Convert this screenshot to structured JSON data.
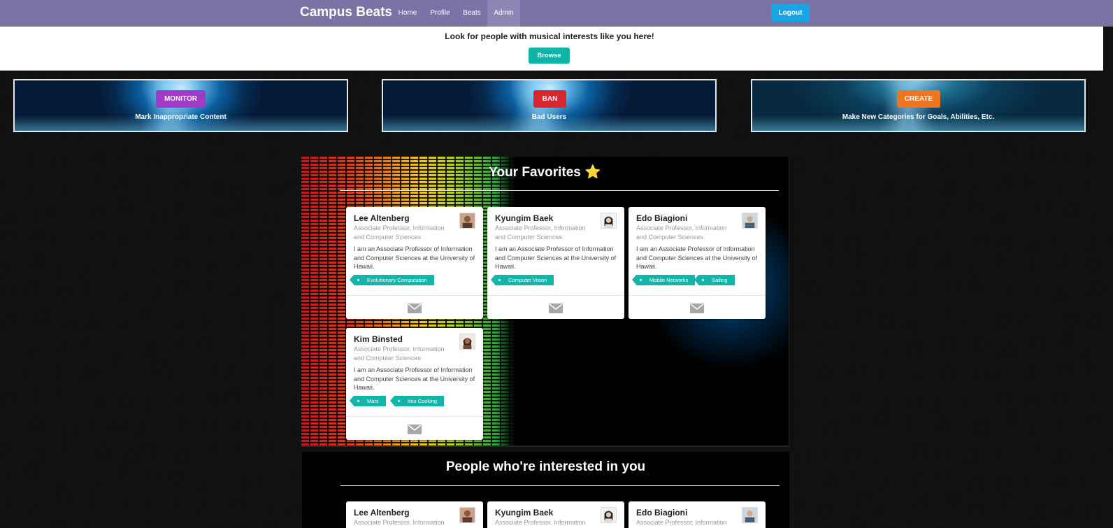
{
  "navbar": {
    "brand": "Campus Beats",
    "items": [
      {
        "label": "Home"
      },
      {
        "label": "Profile"
      },
      {
        "label": "Beats"
      },
      {
        "label": "Admin"
      }
    ],
    "logout_label": "Logout"
  },
  "search": {
    "prompt": "Look for people with musical interests like you here!",
    "browse_label": "Browse"
  },
  "admin_panels": [
    {
      "button": "MONITOR",
      "subtitle": "Mark Inappropriate Content",
      "button_color": "#a03ac7"
    },
    {
      "button": "BAN",
      "subtitle": "Bad Users",
      "button_color": "#d8262c"
    },
    {
      "button": "CREATE",
      "subtitle": "Make New Categories for Goals, Abilities, Etc.",
      "button_color": "#f07521"
    }
  ],
  "favorites": {
    "title": "Your Favorites",
    "star_icon": "⭐",
    "cards": [
      {
        "name": "Lee Altenberg",
        "title": "Associate Professor, Information and Computer Sciences",
        "description": "I am an Associate Professor of Information and Computer Sciences at the University of Hawaii.",
        "tags": [
          "Evolutionary Computation"
        ]
      },
      {
        "name": "Kyungim Baek",
        "title": "Associate Professor, Information and Computer Sciences",
        "description": "I am an Associate Professor of Information and Computer Sciences at the University of Hawaii.",
        "tags": [
          "Computer Vision"
        ]
      },
      {
        "name": "Edo Biagioni",
        "title": "Associate Professor, Information and Computer Sciences",
        "description": "I am an Associate Professor of Information and Computer Sciences at the University of Hawaii.",
        "tags": [
          "Mobile Networks",
          "Sailing"
        ]
      },
      {
        "name": "Kim Binsted",
        "title": "Associate Professor, Information and Computer Sciences",
        "description": "I am an Associate Professor of Information and Computer Sciences at the University of Hawaii.",
        "tags": [
          "Mars",
          "Imu Cooking"
        ]
      }
    ]
  },
  "interested": {
    "title": "People who're interested in you",
    "cards": [
      {
        "name": "Lee Altenberg",
        "title": "Associate Professor, Information"
      },
      {
        "name": "Kyungim Baek",
        "title": "Associate Professor, Information"
      },
      {
        "name": "Edo Biagioni",
        "title": "Associate Professor, Information"
      }
    ]
  },
  "colors": {
    "navbar": "#7b73a6",
    "accent_teal": "#12b5a7",
    "logout": "#16a6e6"
  }
}
